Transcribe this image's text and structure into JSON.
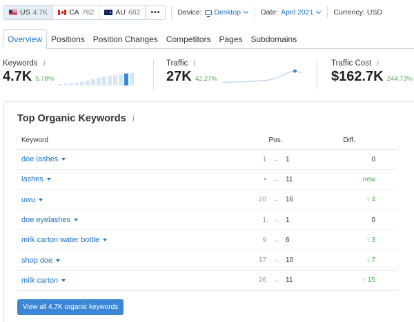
{
  "databases": [
    {
      "code": "US",
      "count": "4.7K",
      "flag": "us",
      "active": true
    },
    {
      "code": "CA",
      "count": "762",
      "flag": "ca",
      "active": false
    },
    {
      "code": "AU",
      "count": "682",
      "flag": "au",
      "active": false
    }
  ],
  "more_label": "•••",
  "filters": {
    "device_label": "Device:",
    "device_value": "Desktop",
    "date_label": "Date:",
    "date_value": "April 2021",
    "currency_label": "Currency: USD"
  },
  "tabs": [
    {
      "label": "Overview",
      "active": true
    },
    {
      "label": "Positions",
      "active": false
    },
    {
      "label": "Position Changes",
      "active": false
    },
    {
      "label": "Competitors",
      "active": false
    },
    {
      "label": "Pages",
      "active": false
    },
    {
      "label": "Subdomains",
      "active": false
    }
  ],
  "metrics": {
    "keywords": {
      "label": "Keywords",
      "value": "4.7K",
      "change": "5.78%",
      "bars": [
        0.12,
        0.14,
        0.18,
        0.22,
        0.3,
        0.4,
        0.52,
        0.62,
        0.72,
        0.8,
        0.86,
        0.92,
        0.97,
        1.0
      ]
    },
    "traffic": {
      "label": "Traffic",
      "value": "27K",
      "change": "42.27%",
      "trend": [
        0.08,
        0.1,
        0.12,
        0.13,
        0.15,
        0.18,
        0.22,
        0.28,
        0.4,
        0.62,
        0.88,
        1.0,
        0.85
      ]
    },
    "cost": {
      "label": "Traffic Cost",
      "value": "$162.7K",
      "change": "244.73%"
    }
  },
  "info_glyph": "i",
  "card": {
    "title": "Top Organic Keywords",
    "columns": {
      "keyword": "Keyword",
      "pos": "Pos.",
      "diff": "Diff."
    },
    "rows": [
      {
        "keyword": "doe lashes",
        "prev": "1",
        "pos": "1",
        "diff": "0",
        "diff_type": "same"
      },
      {
        "keyword": "lashes",
        "prev": "•",
        "pos": "11",
        "diff": "new",
        "diff_type": "new"
      },
      {
        "keyword": "uwu",
        "prev": "20",
        "pos": "16",
        "diff": "↑ 4",
        "diff_type": "up"
      },
      {
        "keyword": "doe eyelashes",
        "prev": "1",
        "pos": "1",
        "diff": "0",
        "diff_type": "same"
      },
      {
        "keyword": "milk carton water bottle",
        "prev": "9",
        "pos": "6",
        "diff": "↑ 3",
        "diff_type": "up"
      },
      {
        "keyword": "shop doe",
        "prev": "17",
        "pos": "10",
        "diff": "↑ 7",
        "diff_type": "up"
      },
      {
        "keyword": "milk carton",
        "prev": "26",
        "pos": "11",
        "diff": "↑ 15",
        "diff_type": "up"
      }
    ],
    "arrow": "→",
    "view_all_label": "View all 4.7K organic keywords"
  },
  "colors": {
    "accent": "#1e73be",
    "positive": "#4caf50",
    "button": "#3b87d6",
    "bar_light": "#d6e6f5",
    "bar_dark": "#3b87d6"
  }
}
